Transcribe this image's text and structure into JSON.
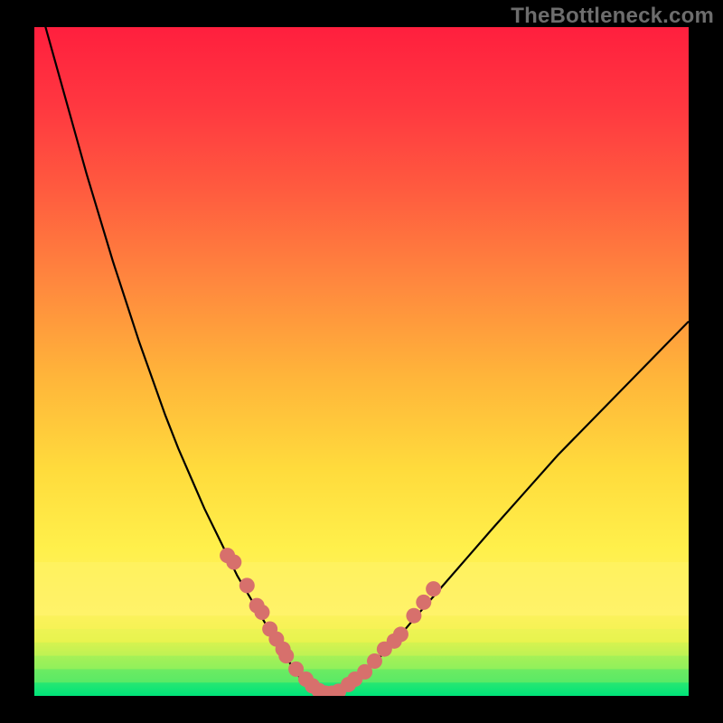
{
  "watermark": "TheBottleneck.com",
  "chart_data": {
    "type": "line",
    "title": "",
    "xlabel": "",
    "ylabel": "",
    "xlim": [
      0,
      100
    ],
    "ylim": [
      0,
      100
    ],
    "grid": false,
    "series": [
      {
        "name": "bottleneck-curve",
        "x": [
          0,
          2,
          4,
          6,
          8,
          10,
          12,
          14,
          16,
          18,
          20,
          22,
          24,
          26,
          28,
          29.5,
          31,
          32.5,
          34,
          35.5,
          37,
          38,
          39,
          40,
          41,
          42,
          43,
          44,
          45,
          46,
          48,
          50,
          52,
          55,
          58,
          62,
          66,
          70,
          75,
          80,
          85,
          90,
          95,
          100
        ],
        "y": [
          106,
          99,
          92,
          85,
          78,
          71.5,
          65,
          59,
          53,
          47.5,
          42,
          37,
          32.5,
          28,
          24,
          21,
          18,
          15.5,
          13,
          10.5,
          8,
          6.5,
          5,
          3.5,
          2.2,
          1.2,
          0.6,
          0.3,
          0.3,
          0.6,
          1.5,
          3,
          5,
          8,
          11.5,
          16,
          20.5,
          25,
          30.5,
          36,
          41,
          46,
          51,
          56
        ]
      }
    ],
    "markers": {
      "name": "highlight-points",
      "color": "#d7706c",
      "x": [
        29.5,
        30.5,
        32.5,
        34,
        34.8,
        36,
        37,
        38,
        38.5,
        40,
        41.5,
        42.5,
        43.5,
        44.5,
        45.5,
        46.5,
        48,
        49,
        50.5,
        52,
        53.5,
        55,
        56,
        58,
        59.5,
        61
      ],
      "y": [
        21,
        20,
        16.5,
        13.5,
        12.5,
        10,
        8.5,
        7,
        6,
        4,
        2.5,
        1.5,
        0.8,
        0.4,
        0.4,
        0.7,
        1.7,
        2.5,
        3.6,
        5.2,
        7,
        8.2,
        9.2,
        12,
        14,
        16
      ]
    },
    "bands": [
      {
        "y0": 0,
        "y1": 2,
        "color": "#00e47a"
      },
      {
        "y0": 2,
        "y1": 4,
        "color": "#5aea66"
      },
      {
        "y0": 4,
        "y1": 6,
        "color": "#9af05a"
      },
      {
        "y0": 6,
        "y1": 8,
        "color": "#c7f352"
      },
      {
        "y0": 8,
        "y1": 10,
        "color": "#e8f34e"
      },
      {
        "y0": 10,
        "y1": 12,
        "color": "#f8f050"
      },
      {
        "y0": 12,
        "y1": 20,
        "color": "#fff36a"
      }
    ],
    "gradient_stops": [
      {
        "pct": 0,
        "color": "#ff1f3e"
      },
      {
        "pct": 12,
        "color": "#ff3840"
      },
      {
        "pct": 24,
        "color": "#ff5a3f"
      },
      {
        "pct": 38,
        "color": "#ff873e"
      },
      {
        "pct": 52,
        "color": "#ffb43a"
      },
      {
        "pct": 66,
        "color": "#ffdb3c"
      },
      {
        "pct": 78,
        "color": "#fff04b"
      },
      {
        "pct": 88,
        "color": "#fff36a"
      },
      {
        "pct": 92,
        "color": "#e8f34e"
      },
      {
        "pct": 95,
        "color": "#9af05a"
      },
      {
        "pct": 98,
        "color": "#5aea66"
      },
      {
        "pct": 100,
        "color": "#00e47a"
      }
    ]
  }
}
